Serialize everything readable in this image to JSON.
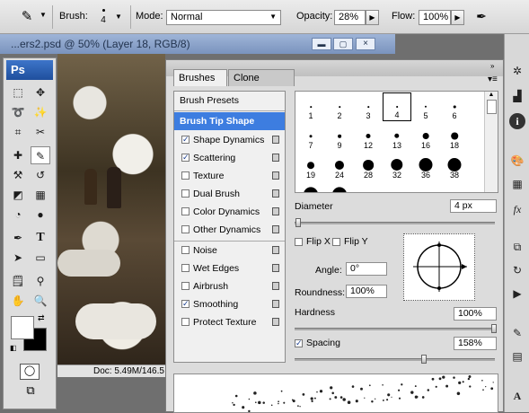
{
  "options_bar": {
    "brush_label": "Brush:",
    "brush_size": "4",
    "mode_label": "Mode:",
    "mode_value": "Normal",
    "opacity_label": "Opacity:",
    "opacity_value": "28%",
    "flow_label": "Flow:",
    "flow_value": "100%"
  },
  "document": {
    "title": "...ers2.psd @ 50% (Layer 18, RGB/8)",
    "status": "Doc: 5.49M/146.5"
  },
  "toolbox": {
    "logo": "Ps"
  },
  "brushes_panel": {
    "tabs": [
      "Brushes",
      "Clone Source"
    ],
    "tab_close": "×",
    "menu_items": [
      {
        "label": "Brush Presets",
        "type": "header"
      },
      {
        "label": "Brush Tip Shape",
        "type": "selected"
      },
      {
        "label": "Shape Dynamics",
        "checked": true
      },
      {
        "label": "Scattering",
        "checked": true
      },
      {
        "label": "Texture",
        "checked": false
      },
      {
        "label": "Dual Brush",
        "checked": false
      },
      {
        "label": "Color Dynamics",
        "checked": false
      },
      {
        "label": "Other Dynamics",
        "checked": false
      },
      {
        "label": "Noise",
        "checked": false
      },
      {
        "label": "Wet Edges",
        "checked": false
      },
      {
        "label": "Airbrush",
        "checked": false
      },
      {
        "label": "Smoothing",
        "checked": true
      },
      {
        "label": "Protect Texture",
        "checked": false
      }
    ],
    "brush_tips": [
      "1",
      "2",
      "3",
      "4",
      "5",
      "6",
      "7",
      "9",
      "12",
      "13",
      "16",
      "18",
      "19",
      "24",
      "28",
      "32",
      "36",
      "38"
    ],
    "selected_tip": "4",
    "diameter_label": "Diameter",
    "diameter_value": "4 px",
    "flip_x_label": "Flip X",
    "flip_y_label": "Flip Y",
    "angle_label": "Angle:",
    "angle_value": "0°",
    "roundness_label": "Roundness:",
    "roundness_value": "100%",
    "hardness_label": "Hardness",
    "hardness_value": "100%",
    "spacing_label": "Spacing",
    "spacing_value": "158%",
    "spacing_checked": true
  }
}
